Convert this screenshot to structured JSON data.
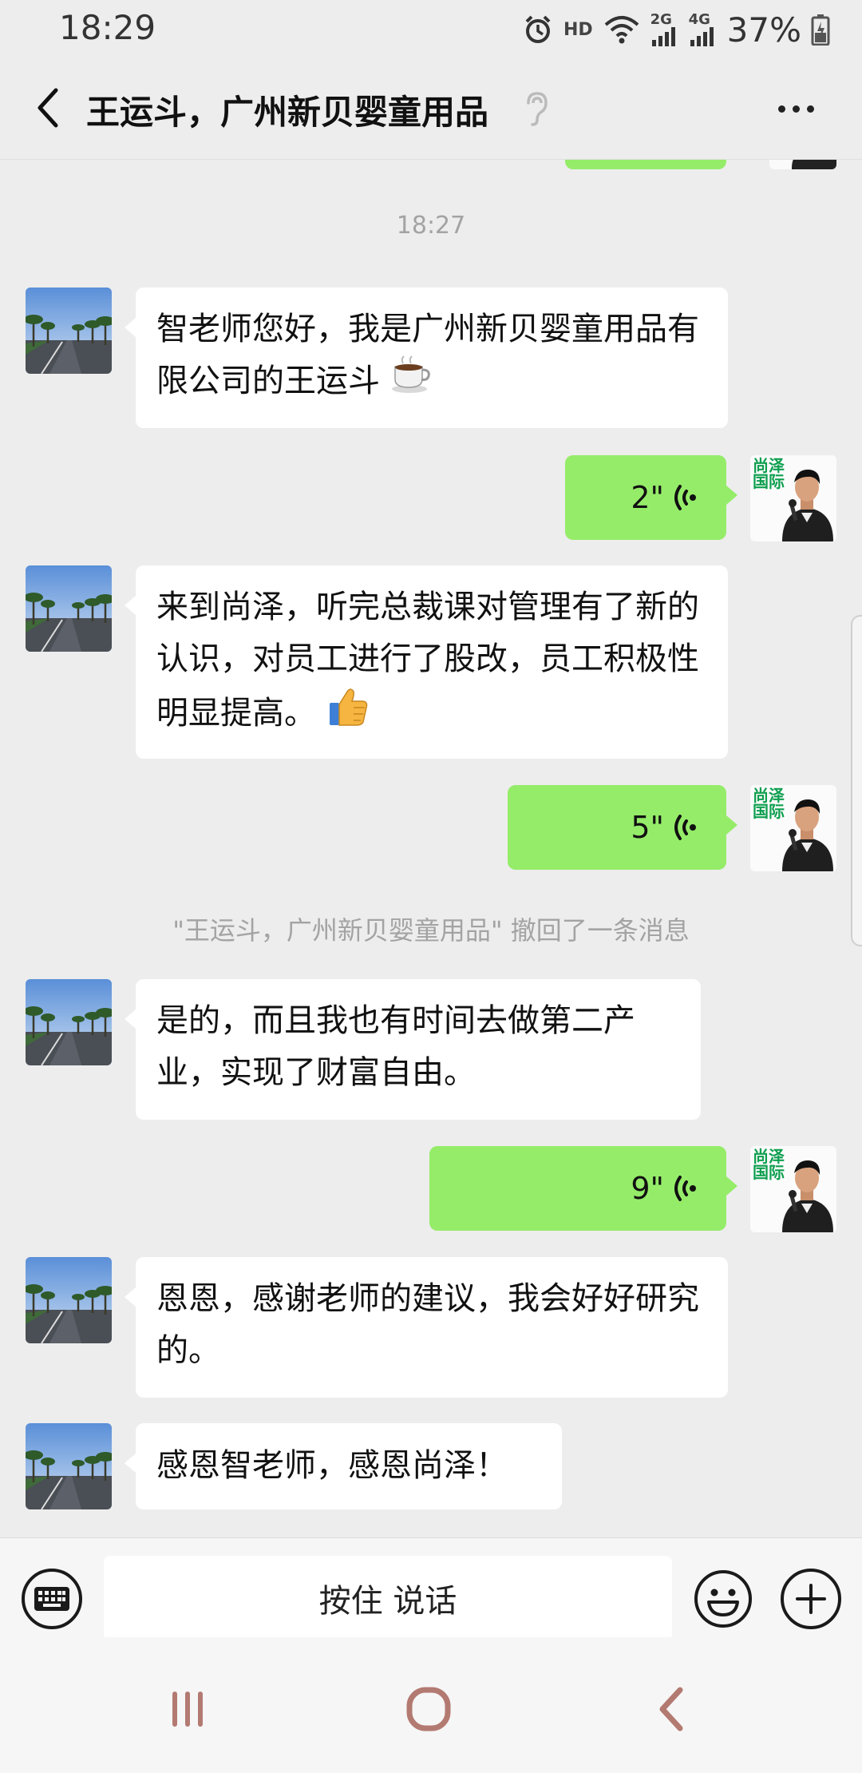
{
  "status_bar": {
    "time": "18:29",
    "hd_label": "HD",
    "net_2g": "2G",
    "net_4g": "4G",
    "battery": "37%"
  },
  "header": {
    "title": "王运斗，广州新贝婴童用品"
  },
  "messages": {
    "timestamp": "18:27",
    "m1": "智老师您好，我是广州新贝婴童用品有限公司的王运斗",
    "v1": "2\"",
    "m2": "来到尚泽，听完总裁课对管理有了新的认识，对员工进行了股改，员工积极性明显提高。",
    "v2": "5\"",
    "recall": "\"王运斗，广州新贝婴童用品\" 撤回了一条消息",
    "m3": "是的，而且我也有时间去做第二产业，实现了财富自由。",
    "v3": "9\"",
    "m4": "恩恩，感谢老师的建议，我会好好研究的。",
    "m5": "感恩智老师，感恩尚泽！"
  },
  "avatar_text": {
    "line1": "尚泽",
    "line2": "国际"
  },
  "input_bar": {
    "hold_to_talk": "按住 说话"
  },
  "icons": [
    "back-arrow-icon",
    "mute-ear-icon",
    "more-icon",
    "voice-wave-icon",
    "keyboard-icon",
    "emoji-icon",
    "plus-icon",
    "recents-icon",
    "home-icon",
    "nav-back-icon",
    "coffee-emoji",
    "thumbs-up-emoji"
  ],
  "colors": {
    "background": "#ededed",
    "outgoing_bubble": "#95ec69",
    "incoming_bubble": "#ffffff",
    "logo_green": "#0e9f4f"
  }
}
